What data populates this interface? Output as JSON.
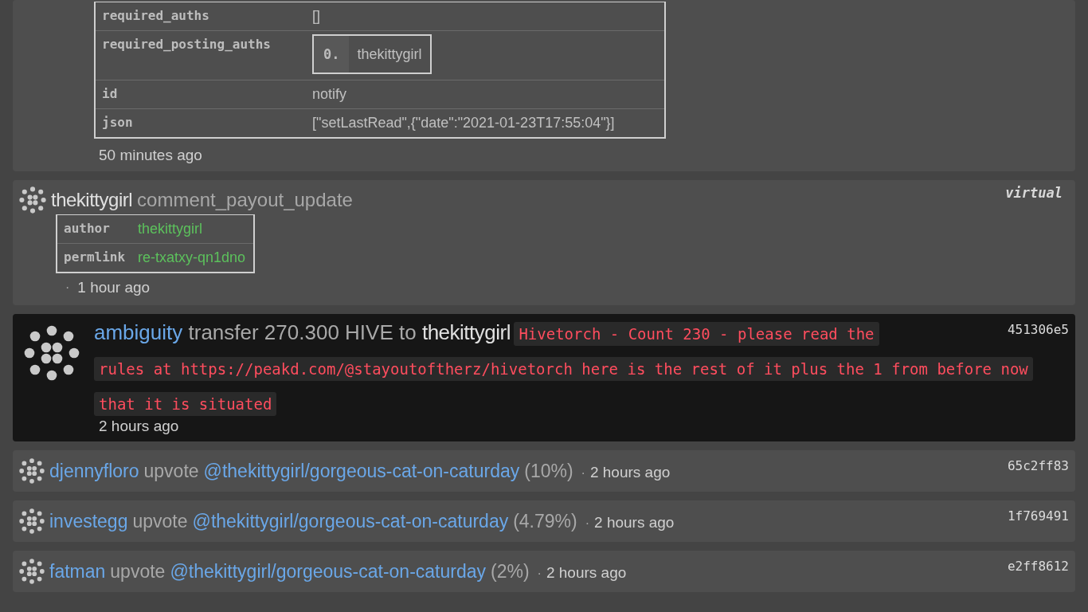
{
  "operations": [
    {
      "kind": "custom_json",
      "table": [
        {
          "key": "required_auths",
          "value": "[]",
          "kind": "text"
        },
        {
          "key": "required_posting_auths",
          "kind": "list",
          "items": [
            {
              "index": "0.",
              "value": "thekittygirl"
            }
          ]
        },
        {
          "key": "id",
          "value": "notify",
          "kind": "text"
        },
        {
          "key": "json",
          "value": "[\"setLastRead\",{\"date\":\"2021-01-23T17:55:04\"}]",
          "kind": "text"
        }
      ],
      "time": "50 minutes ago"
    },
    {
      "kind": "generic",
      "account": "thekittygirl",
      "op": "comment_payout_update",
      "badge": "virtual",
      "table": [
        {
          "key": "author",
          "value": "thekittygirl",
          "kind": "link"
        },
        {
          "key": "permlink",
          "value": "re-txatxy-qn1dno",
          "kind": "link"
        }
      ],
      "separator": "·",
      "time": "1 hour ago"
    },
    {
      "kind": "transfer",
      "highlighted": true,
      "from": "ambiguity",
      "verb": "transfer 270.300 HIVE to",
      "to": "thekittygirl",
      "memo_lines": [
        "Hivetorch - Count 230 - please read the",
        "rules at https://peakd.com/@stayoutoftherz/hivetorch here is the rest of it plus the 1 from before now",
        "that it is situated"
      ],
      "time": "2 hours ago",
      "tx": "451306e5"
    },
    {
      "kind": "vote",
      "voter": "djennyfloro",
      "verb": "upvote",
      "post": "@thekittygirl/gorgeous-cat-on-caturday",
      "weight": "(10%)",
      "separator": "·",
      "time": "2 hours ago",
      "tx": "65c2ff83"
    },
    {
      "kind": "vote",
      "voter": "investegg",
      "verb": "upvote",
      "post": "@thekittygirl/gorgeous-cat-on-caturday",
      "weight": "(4.79%)",
      "separator": "·",
      "time": "2 hours ago",
      "tx": "1f769491"
    },
    {
      "kind": "vote",
      "voter": "fatman",
      "verb": "upvote",
      "post": "@thekittygirl/gorgeous-cat-on-caturday",
      "weight": "(2%)",
      "separator": "·",
      "time": "2 hours ago",
      "tx": "e2ff8612"
    }
  ]
}
